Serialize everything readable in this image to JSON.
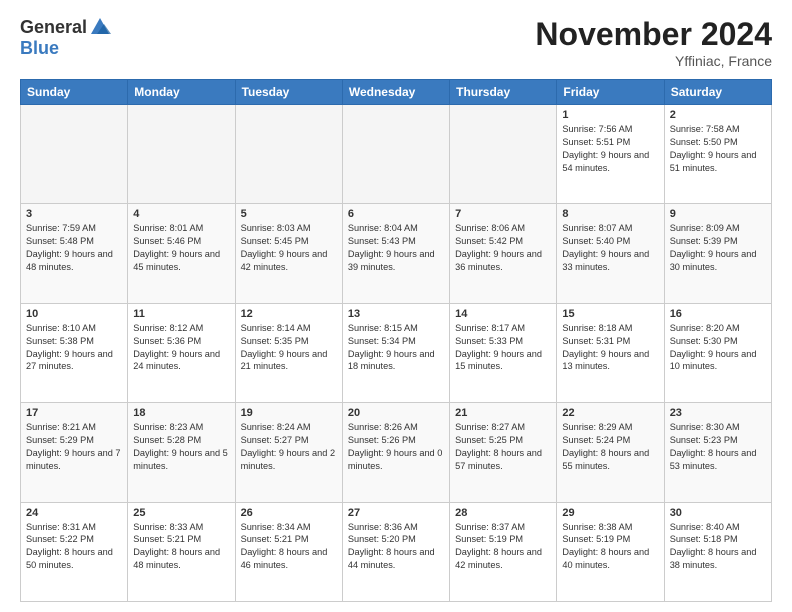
{
  "header": {
    "logo_general": "General",
    "logo_blue": "Blue",
    "month_title": "November 2024",
    "location": "Yffiniac, France"
  },
  "weekdays": [
    "Sunday",
    "Monday",
    "Tuesday",
    "Wednesday",
    "Thursday",
    "Friday",
    "Saturday"
  ],
  "weeks": [
    [
      {
        "day": "",
        "sunrise": "",
        "sunset": "",
        "daylight": ""
      },
      {
        "day": "",
        "sunrise": "",
        "sunset": "",
        "daylight": ""
      },
      {
        "day": "",
        "sunrise": "",
        "sunset": "",
        "daylight": ""
      },
      {
        "day": "",
        "sunrise": "",
        "sunset": "",
        "daylight": ""
      },
      {
        "day": "",
        "sunrise": "",
        "sunset": "",
        "daylight": ""
      },
      {
        "day": "1",
        "sunrise": "Sunrise: 7:56 AM",
        "sunset": "Sunset: 5:51 PM",
        "daylight": "Daylight: 9 hours and 54 minutes."
      },
      {
        "day": "2",
        "sunrise": "Sunrise: 7:58 AM",
        "sunset": "Sunset: 5:50 PM",
        "daylight": "Daylight: 9 hours and 51 minutes."
      }
    ],
    [
      {
        "day": "3",
        "sunrise": "Sunrise: 7:59 AM",
        "sunset": "Sunset: 5:48 PM",
        "daylight": "Daylight: 9 hours and 48 minutes."
      },
      {
        "day": "4",
        "sunrise": "Sunrise: 8:01 AM",
        "sunset": "Sunset: 5:46 PM",
        "daylight": "Daylight: 9 hours and 45 minutes."
      },
      {
        "day": "5",
        "sunrise": "Sunrise: 8:03 AM",
        "sunset": "Sunset: 5:45 PM",
        "daylight": "Daylight: 9 hours and 42 minutes."
      },
      {
        "day": "6",
        "sunrise": "Sunrise: 8:04 AM",
        "sunset": "Sunset: 5:43 PM",
        "daylight": "Daylight: 9 hours and 39 minutes."
      },
      {
        "day": "7",
        "sunrise": "Sunrise: 8:06 AM",
        "sunset": "Sunset: 5:42 PM",
        "daylight": "Daylight: 9 hours and 36 minutes."
      },
      {
        "day": "8",
        "sunrise": "Sunrise: 8:07 AM",
        "sunset": "Sunset: 5:40 PM",
        "daylight": "Daylight: 9 hours and 33 minutes."
      },
      {
        "day": "9",
        "sunrise": "Sunrise: 8:09 AM",
        "sunset": "Sunset: 5:39 PM",
        "daylight": "Daylight: 9 hours and 30 minutes."
      }
    ],
    [
      {
        "day": "10",
        "sunrise": "Sunrise: 8:10 AM",
        "sunset": "Sunset: 5:38 PM",
        "daylight": "Daylight: 9 hours and 27 minutes."
      },
      {
        "day": "11",
        "sunrise": "Sunrise: 8:12 AM",
        "sunset": "Sunset: 5:36 PM",
        "daylight": "Daylight: 9 hours and 24 minutes."
      },
      {
        "day": "12",
        "sunrise": "Sunrise: 8:14 AM",
        "sunset": "Sunset: 5:35 PM",
        "daylight": "Daylight: 9 hours and 21 minutes."
      },
      {
        "day": "13",
        "sunrise": "Sunrise: 8:15 AM",
        "sunset": "Sunset: 5:34 PM",
        "daylight": "Daylight: 9 hours and 18 minutes."
      },
      {
        "day": "14",
        "sunrise": "Sunrise: 8:17 AM",
        "sunset": "Sunset: 5:33 PM",
        "daylight": "Daylight: 9 hours and 15 minutes."
      },
      {
        "day": "15",
        "sunrise": "Sunrise: 8:18 AM",
        "sunset": "Sunset: 5:31 PM",
        "daylight": "Daylight: 9 hours and 13 minutes."
      },
      {
        "day": "16",
        "sunrise": "Sunrise: 8:20 AM",
        "sunset": "Sunset: 5:30 PM",
        "daylight": "Daylight: 9 hours and 10 minutes."
      }
    ],
    [
      {
        "day": "17",
        "sunrise": "Sunrise: 8:21 AM",
        "sunset": "Sunset: 5:29 PM",
        "daylight": "Daylight: 9 hours and 7 minutes."
      },
      {
        "day": "18",
        "sunrise": "Sunrise: 8:23 AM",
        "sunset": "Sunset: 5:28 PM",
        "daylight": "Daylight: 9 hours and 5 minutes."
      },
      {
        "day": "19",
        "sunrise": "Sunrise: 8:24 AM",
        "sunset": "Sunset: 5:27 PM",
        "daylight": "Daylight: 9 hours and 2 minutes."
      },
      {
        "day": "20",
        "sunrise": "Sunrise: 8:26 AM",
        "sunset": "Sunset: 5:26 PM",
        "daylight": "Daylight: 9 hours and 0 minutes."
      },
      {
        "day": "21",
        "sunrise": "Sunrise: 8:27 AM",
        "sunset": "Sunset: 5:25 PM",
        "daylight": "Daylight: 8 hours and 57 minutes."
      },
      {
        "day": "22",
        "sunrise": "Sunrise: 8:29 AM",
        "sunset": "Sunset: 5:24 PM",
        "daylight": "Daylight: 8 hours and 55 minutes."
      },
      {
        "day": "23",
        "sunrise": "Sunrise: 8:30 AM",
        "sunset": "Sunset: 5:23 PM",
        "daylight": "Daylight: 8 hours and 53 minutes."
      }
    ],
    [
      {
        "day": "24",
        "sunrise": "Sunrise: 8:31 AM",
        "sunset": "Sunset: 5:22 PM",
        "daylight": "Daylight: 8 hours and 50 minutes."
      },
      {
        "day": "25",
        "sunrise": "Sunrise: 8:33 AM",
        "sunset": "Sunset: 5:21 PM",
        "daylight": "Daylight: 8 hours and 48 minutes."
      },
      {
        "day": "26",
        "sunrise": "Sunrise: 8:34 AM",
        "sunset": "Sunset: 5:21 PM",
        "daylight": "Daylight: 8 hours and 46 minutes."
      },
      {
        "day": "27",
        "sunrise": "Sunrise: 8:36 AM",
        "sunset": "Sunset: 5:20 PM",
        "daylight": "Daylight: 8 hours and 44 minutes."
      },
      {
        "day": "28",
        "sunrise": "Sunrise: 8:37 AM",
        "sunset": "Sunset: 5:19 PM",
        "daylight": "Daylight: 8 hours and 42 minutes."
      },
      {
        "day": "29",
        "sunrise": "Sunrise: 8:38 AM",
        "sunset": "Sunset: 5:19 PM",
        "daylight": "Daylight: 8 hours and 40 minutes."
      },
      {
        "day": "30",
        "sunrise": "Sunrise: 8:40 AM",
        "sunset": "Sunset: 5:18 PM",
        "daylight": "Daylight: 8 hours and 38 minutes."
      }
    ]
  ]
}
